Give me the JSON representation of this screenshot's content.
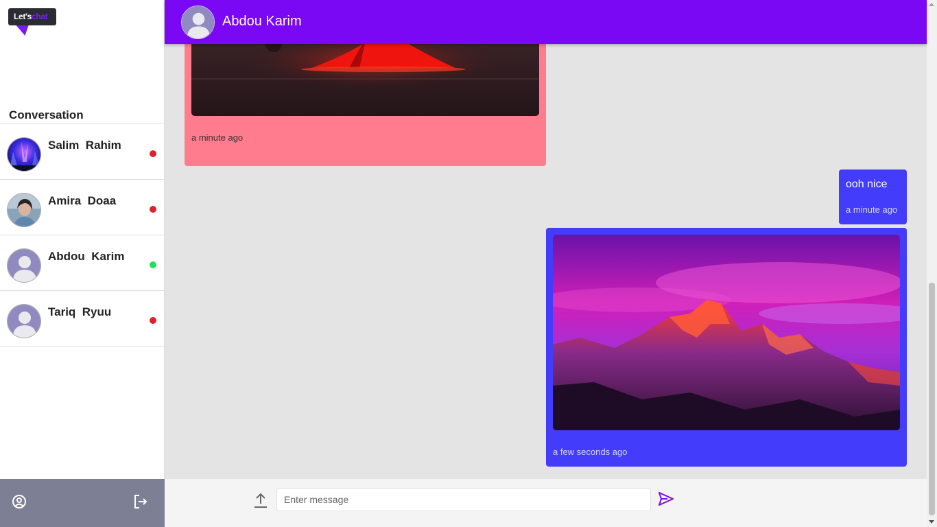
{
  "logo": {
    "text_lets": "Let's",
    "text_chat": "chat"
  },
  "sidebar": {
    "section_title": "Conversation",
    "conversations": [
      {
        "name": "Salim  Rahim",
        "status": "offline",
        "status_color": "#e0202c",
        "avatar": "aurora"
      },
      {
        "name": "Amira  Doaa",
        "status": "offline",
        "status_color": "#e0202c",
        "avatar": "photo-woman"
      },
      {
        "name": "Abdou  Karim",
        "status": "online",
        "status_color": "#1ee15a",
        "avatar": "default-user"
      },
      {
        "name": "Tariq  Ryuu",
        "status": "offline",
        "status_color": "#e0202c",
        "avatar": "default-user"
      }
    ],
    "footer": {
      "profile_icon": "user-circle-icon",
      "logout_icon": "logout-icon"
    }
  },
  "header": {
    "name": "Abdou Karim",
    "avatar": "default-user"
  },
  "messages": [
    {
      "direction": "received",
      "type": "image",
      "image": "red-tent-night",
      "time": "a minute ago"
    },
    {
      "direction": "sent",
      "type": "text",
      "text": "ooh nice",
      "time": "a minute ago"
    },
    {
      "direction": "sent",
      "type": "image",
      "image": "purple-mountain-sunset",
      "time": "a few seconds ago"
    }
  ],
  "composer": {
    "placeholder": "Enter message",
    "value": ""
  },
  "colors": {
    "header": "#7a08f5",
    "received_bubble": "#ff7c8f",
    "sent_bubble": "#433cfa",
    "sidebar_footer": "#7d7f95",
    "accent": "#7a1cf0"
  }
}
